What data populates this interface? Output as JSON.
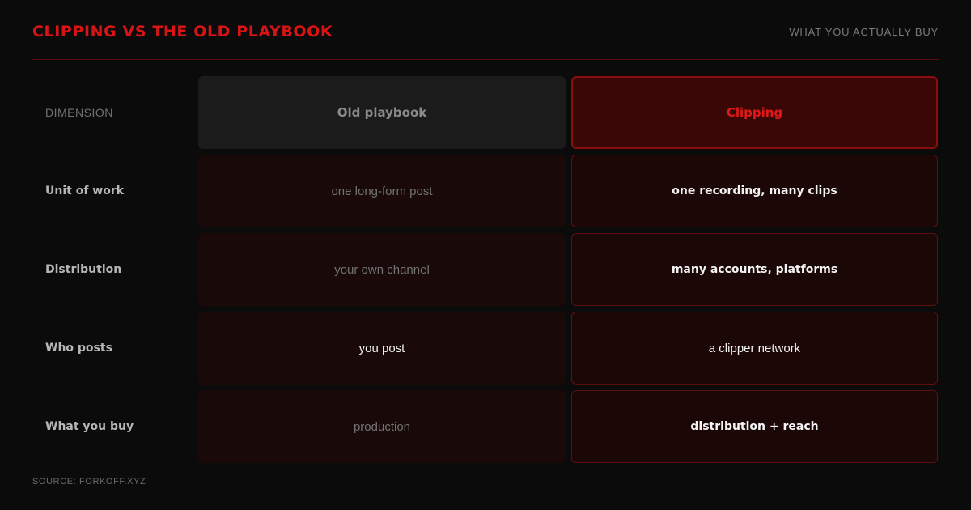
{
  "header": {
    "title": "CLIPPING VS THE OLD PLAYBOOK",
    "subtitle": "WHAT YOU ACTUALLY BUY"
  },
  "table": {
    "columns": {
      "dimension": "DIMENSION",
      "old": "Old playbook",
      "new": "Clipping"
    },
    "rows": [
      {
        "label": "Unit of work",
        "old": "one long-form post",
        "new": "one recording, many clips"
      },
      {
        "label": "Distribution",
        "old": "your own channel",
        "new": "many accounts, platforms"
      },
      {
        "label": "Who posts",
        "old": "you post",
        "new": "a clipper network"
      },
      {
        "label": "What you buy",
        "old": "production",
        "new": "distribution + reach"
      }
    ]
  },
  "footer": {
    "source": "SOURCE: FORKOFF.XYZ"
  },
  "colors": {
    "accent": "#d81414",
    "background": "#0b0b0b"
  }
}
